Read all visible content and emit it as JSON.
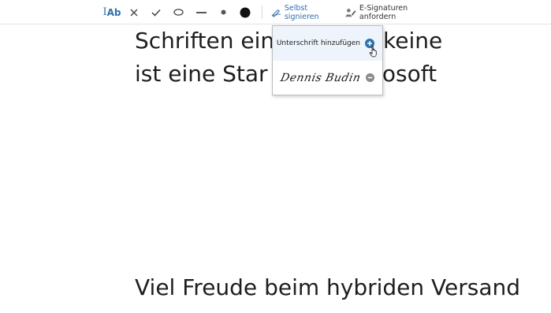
{
  "toolbar": {
    "text_tool_prefix": "I",
    "text_tool_label": "Ab",
    "self_sign_label": "Selbst signieren",
    "request_label": "E-Signaturen anfordern",
    "icons": [
      "text-tool-icon",
      "cross-icon",
      "checkmark-icon",
      "ellipse-icon",
      "line-icon",
      "small-dot-icon",
      "large-dot-icon",
      "pen-sign-icon",
      "users-sign-icon"
    ]
  },
  "document": {
    "line1": "Schriften ein        sind und keine",
    "line2": "ist eine Star         on in Microsoft",
    "line3": "Viel Freude beim hybriden Versand"
  },
  "dropdown": {
    "add_label": "Unterschrift hinzufügen",
    "signature_name": "Dennis Budin"
  },
  "colors": {
    "accent": "#2f6fab",
    "add_icon": "#2f6fab",
    "remove_icon": "#8a8a8a"
  }
}
